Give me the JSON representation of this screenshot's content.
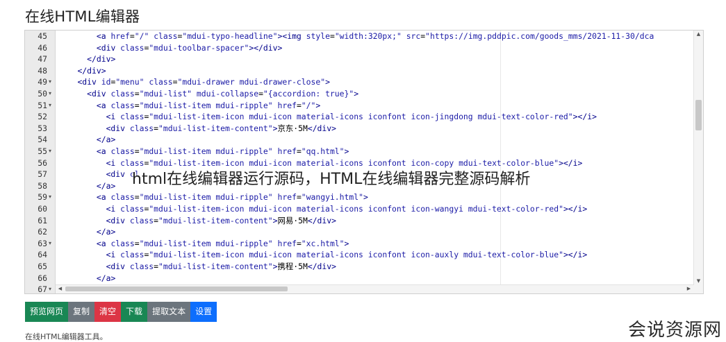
{
  "page": {
    "title": "在线HTML编辑器",
    "overlay_caption": "html在线编辑器运行源码，HTML在线编辑器完整源码解析",
    "footer_note": "在线HTML编辑器工具。",
    "watermark": "会说资源网"
  },
  "editor": {
    "lines": [
      {
        "num": "45",
        "fold": "",
        "tokens": [
          [
            "t",
            "        "
          ],
          [
            "g",
            "<a "
          ],
          [
            "a",
            "href"
          ],
          [
            "t",
            "="
          ],
          [
            "s",
            "\"/\""
          ],
          [
            "t",
            " "
          ],
          [
            "a",
            "class"
          ],
          [
            "t",
            "="
          ],
          [
            "s",
            "\"mdui-typo-headline\""
          ],
          [
            "g",
            ">"
          ],
          [
            "g",
            "<img "
          ],
          [
            "a",
            "style"
          ],
          [
            "t",
            "="
          ],
          [
            "s",
            "\"width:320px;\""
          ],
          [
            "t",
            " "
          ],
          [
            "a",
            "src"
          ],
          [
            "t",
            "="
          ],
          [
            "s",
            "\"https://img.pddpic.com/goods_mms/2021-11-30/dca"
          ]
        ]
      },
      {
        "num": "46",
        "fold": "",
        "tokens": [
          [
            "t",
            "        "
          ],
          [
            "g",
            "<div "
          ],
          [
            "a",
            "class"
          ],
          [
            "t",
            "="
          ],
          [
            "s",
            "\"mdui-toolbar-spacer\""
          ],
          [
            "g",
            "></div>"
          ]
        ]
      },
      {
        "num": "47",
        "fold": "",
        "tokens": [
          [
            "t",
            "      "
          ],
          [
            "g",
            "</div>"
          ]
        ]
      },
      {
        "num": "48",
        "fold": "",
        "tokens": [
          [
            "t",
            "    "
          ],
          [
            "g",
            "</div>"
          ]
        ]
      },
      {
        "num": "49",
        "fold": "▾",
        "tokens": [
          [
            "t",
            "    "
          ],
          [
            "g",
            "<div "
          ],
          [
            "a",
            "id"
          ],
          [
            "t",
            "="
          ],
          [
            "s",
            "\"menu\""
          ],
          [
            "t",
            " "
          ],
          [
            "a",
            "class"
          ],
          [
            "t",
            "="
          ],
          [
            "s",
            "\"mdui-drawer mdui-drawer-close\""
          ],
          [
            "g",
            ">"
          ]
        ]
      },
      {
        "num": "50",
        "fold": "▾",
        "tokens": [
          [
            "t",
            "      "
          ],
          [
            "g",
            "<div "
          ],
          [
            "a",
            "class"
          ],
          [
            "t",
            "="
          ],
          [
            "s",
            "\"mdui-list\""
          ],
          [
            "t",
            " "
          ],
          [
            "a",
            "mdui-collapse"
          ],
          [
            "t",
            "="
          ],
          [
            "s",
            "\"{accordion: true}\""
          ],
          [
            "g",
            ">"
          ]
        ]
      },
      {
        "num": "51",
        "fold": "▾",
        "tokens": [
          [
            "t",
            "        "
          ],
          [
            "g",
            "<a "
          ],
          [
            "a",
            "class"
          ],
          [
            "t",
            "="
          ],
          [
            "s",
            "\"mdui-list-item mdui-ripple\""
          ],
          [
            "t",
            " "
          ],
          [
            "a",
            "href"
          ],
          [
            "t",
            "="
          ],
          [
            "s",
            "\"/\""
          ],
          [
            "g",
            ">"
          ]
        ]
      },
      {
        "num": "52",
        "fold": "",
        "tokens": [
          [
            "t",
            "          "
          ],
          [
            "g",
            "<i "
          ],
          [
            "a",
            "class"
          ],
          [
            "t",
            "="
          ],
          [
            "s",
            "\"mdui-list-item-icon mdui-icon material-icons iconfont icon-jingdong mdui-text-color-red\""
          ],
          [
            "g",
            "></i>"
          ]
        ]
      },
      {
        "num": "53",
        "fold": "",
        "tokens": [
          [
            "t",
            "          "
          ],
          [
            "g",
            "<div "
          ],
          [
            "a",
            "class"
          ],
          [
            "t",
            "="
          ],
          [
            "s",
            "\"mdui-list-item-content\""
          ],
          [
            "g",
            ">"
          ],
          [
            "t",
            "京东·5M"
          ],
          [
            "g",
            "</div>"
          ]
        ]
      },
      {
        "num": "54",
        "fold": "",
        "tokens": [
          [
            "t",
            "        "
          ],
          [
            "g",
            "</a>"
          ]
        ]
      },
      {
        "num": "55",
        "fold": "▾",
        "tokens": [
          [
            "t",
            "        "
          ],
          [
            "g",
            "<a "
          ],
          [
            "a",
            "class"
          ],
          [
            "t",
            "="
          ],
          [
            "s",
            "\"mdui-list-item mdui-ripple\""
          ],
          [
            "t",
            " "
          ],
          [
            "a",
            "href"
          ],
          [
            "t",
            "="
          ],
          [
            "s",
            "\"qq.html\""
          ],
          [
            "g",
            ">"
          ]
        ]
      },
      {
        "num": "56",
        "fold": "",
        "tokens": [
          [
            "t",
            "          "
          ],
          [
            "g",
            "<i "
          ],
          [
            "a",
            "class"
          ],
          [
            "t",
            "="
          ],
          [
            "s",
            "\"mdui-list-item-icon mdui-icon material-icons iconfont icon-copy mdui-text-color-blue\""
          ],
          [
            "g",
            "></i>"
          ]
        ]
      },
      {
        "num": "57",
        "fold": "",
        "tokens": [
          [
            "t",
            "          "
          ],
          [
            "g",
            "<div "
          ],
          [
            "a",
            "cl"
          ]
        ]
      },
      {
        "num": "58",
        "fold": "",
        "tokens": [
          [
            "t",
            "        "
          ],
          [
            "g",
            "</a>"
          ]
        ]
      },
      {
        "num": "59",
        "fold": "▾",
        "tokens": [
          [
            "t",
            "        "
          ],
          [
            "g",
            "<a "
          ],
          [
            "a",
            "class"
          ],
          [
            "t",
            "="
          ],
          [
            "s",
            "\"mdui-list-item mdui-ripple\""
          ],
          [
            "t",
            " "
          ],
          [
            "a",
            "href"
          ],
          [
            "t",
            "="
          ],
          [
            "s",
            "\"wangyi.html\""
          ],
          [
            "g",
            ">"
          ]
        ]
      },
      {
        "num": "60",
        "fold": "",
        "tokens": [
          [
            "t",
            "          "
          ],
          [
            "g",
            "<i "
          ],
          [
            "a",
            "class"
          ],
          [
            "t",
            "="
          ],
          [
            "s",
            "\"mdui-list-item-icon mdui-icon material-icons iconfont icon-wangyi mdui-text-color-red\""
          ],
          [
            "g",
            "></i>"
          ]
        ]
      },
      {
        "num": "61",
        "fold": "",
        "tokens": [
          [
            "t",
            "          "
          ],
          [
            "g",
            "<div "
          ],
          [
            "a",
            "class"
          ],
          [
            "t",
            "="
          ],
          [
            "s",
            "\"mdui-list-item-content\""
          ],
          [
            "g",
            ">"
          ],
          [
            "t",
            "网易·5M"
          ],
          [
            "g",
            "</div>"
          ]
        ]
      },
      {
        "num": "62",
        "fold": "",
        "tokens": [
          [
            "t",
            "        "
          ],
          [
            "g",
            "</a>"
          ]
        ]
      },
      {
        "num": "63",
        "fold": "▾",
        "tokens": [
          [
            "t",
            "        "
          ],
          [
            "g",
            "<a "
          ],
          [
            "a",
            "class"
          ],
          [
            "t",
            "="
          ],
          [
            "s",
            "\"mdui-list-item mdui-ripple\""
          ],
          [
            "t",
            " "
          ],
          [
            "a",
            "href"
          ],
          [
            "t",
            "="
          ],
          [
            "s",
            "\"xc.html\""
          ],
          [
            "g",
            ">"
          ]
        ]
      },
      {
        "num": "64",
        "fold": "",
        "tokens": [
          [
            "t",
            "          "
          ],
          [
            "g",
            "<i "
          ],
          [
            "a",
            "class"
          ],
          [
            "t",
            "="
          ],
          [
            "s",
            "\"mdui-list-item-icon mdui-icon material-icons iconfont icon-auxly mdui-text-color-blue\""
          ],
          [
            "g",
            "></i>"
          ]
        ]
      },
      {
        "num": "65",
        "fold": "",
        "tokens": [
          [
            "t",
            "          "
          ],
          [
            "g",
            "<div "
          ],
          [
            "a",
            "class"
          ],
          [
            "t",
            "="
          ],
          [
            "s",
            "\"mdui-list-item-content\""
          ],
          [
            "g",
            ">"
          ],
          [
            "t",
            "携程·5M"
          ],
          [
            "g",
            "</div>"
          ]
        ]
      },
      {
        "num": "66",
        "fold": "",
        "tokens": [
          [
            "t",
            "        "
          ],
          [
            "g",
            "</a>"
          ]
        ]
      },
      {
        "num": "67",
        "fold": "▾",
        "tokens": []
      }
    ]
  },
  "buttons": [
    {
      "name": "preview-button",
      "label": "预览网页",
      "color": "#198754"
    },
    {
      "name": "copy-button",
      "label": "复制",
      "color": "#6c757d"
    },
    {
      "name": "clear-button",
      "label": "清空",
      "color": "#dc3545"
    },
    {
      "name": "download-button",
      "label": "下载",
      "color": "#198754"
    },
    {
      "name": "extract-text-button",
      "label": "提取文本",
      "color": "#6c757d"
    },
    {
      "name": "settings-button",
      "label": "设置",
      "color": "#0d6efd"
    }
  ],
  "icons": {
    "scroll_up": "triangle-up-icon",
    "scroll_down": "triangle-down-icon",
    "scroll_left": "triangle-left-icon",
    "scroll_right": "triangle-right-icon",
    "fold": "fold-arrow-icon"
  }
}
